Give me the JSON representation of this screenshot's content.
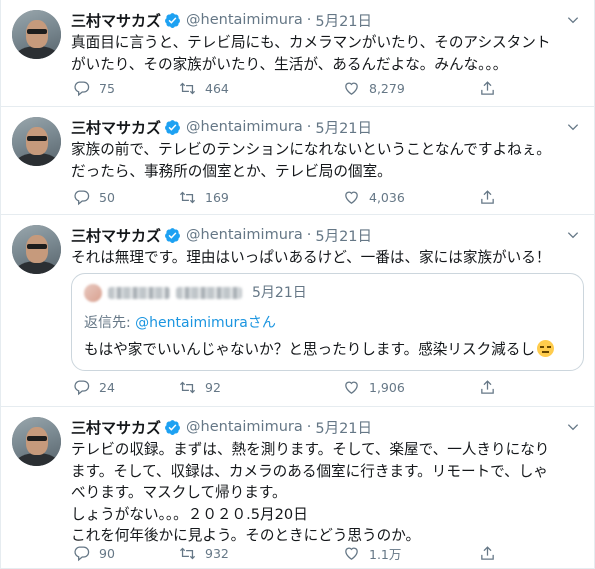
{
  "author": {
    "name": "三村マサカズ",
    "handle": "@hentaimimura",
    "separator": "·"
  },
  "colors": {
    "text": "#14171a",
    "secondary": "#657786",
    "link": "#1b95e0",
    "verified": "#1da1f2",
    "border": "#e6ecf0"
  },
  "icons": {
    "reply": "reply-icon",
    "retweet": "retweet-icon",
    "like": "heart-icon",
    "share": "share-icon",
    "caret": "chevron-down-icon",
    "verified": "verified-badge-icon"
  },
  "tweets": [
    {
      "date": "5月21日",
      "text": "真面目に言うと、テレビ局にも、カメラマンがいたり、そのアシスタント\nがいたり、その家族がいたり、生活が、あるんだよな。みんな。。。",
      "replies": "75",
      "retweets": "464",
      "likes": "8,279"
    },
    {
      "date": "5月21日",
      "text": "家族の前で、テレビのテンションになれないということなんですよねぇ。\nだったら、事務所の個室とか、テレビ局の個室。",
      "replies": "50",
      "retweets": "169",
      "likes": "4,036"
    },
    {
      "date": "5月21日",
      "text": "それは無理です。理由はいっぱいあるけど、一番は、家には家族がいる！",
      "replies": "24",
      "retweets": "92",
      "likes": "1,906",
      "quote": {
        "date": "5月21日",
        "reply_prefix": "返信先: ",
        "reply_handle": "@hentaimimuraさん",
        "text": "もはや家でいいんじゃないか？と思ったりします。感染リスク減るし"
      }
    },
    {
      "date": "5月21日",
      "text": "テレビの収録。まずは、熱を測ります。そして、楽屋で、一人きりになり\nます。そして、収録は、カメラのある個室に行きます。リモートで、しゃ\nべります。マスクして帰ります。\nしょうがない。。。２０２０.5月20日\nこれを何年後かに見よう。そのときにどう思うのか。",
      "replies": "90",
      "retweets": "932",
      "likes": "1.1万"
    }
  ]
}
